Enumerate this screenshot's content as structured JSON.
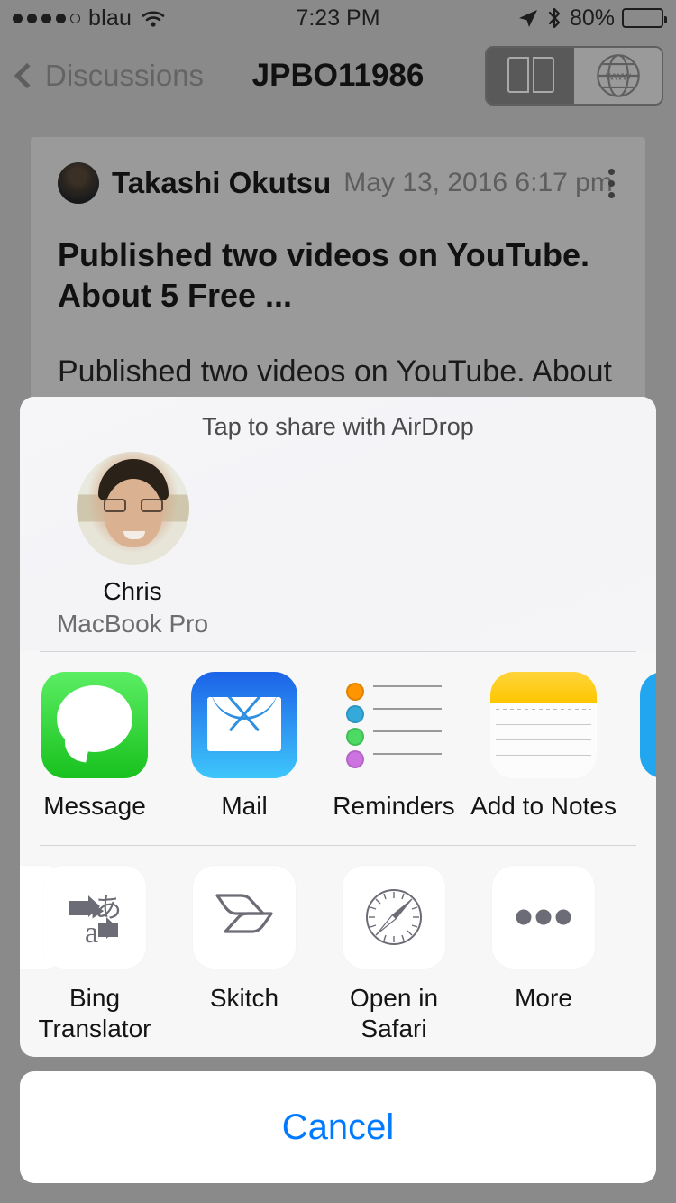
{
  "status_bar": {
    "carrier": "blau",
    "signal_dots_filled": 4,
    "signal_dots_total": 5,
    "wifi_icon": "wifi-icon",
    "time": "7:23 PM",
    "location_icon": "location-arrow-icon",
    "bluetooth_icon": "bluetooth-icon",
    "battery_percent": "80%",
    "battery_level": 80
  },
  "nav_bar": {
    "back_label": "Discussions",
    "back_icon": "chevron-left-icon",
    "title": "JPBO11986",
    "segmented_control": {
      "options": [
        {
          "name": "reader-view",
          "icon": "book-icon",
          "selected": true
        },
        {
          "name": "web-view",
          "icon": "globe-www-icon",
          "selected": false
        }
      ]
    }
  },
  "post": {
    "avatar": "author-avatar",
    "author": "Takashi Okutsu",
    "date": "May 13, 2016 6:17 pm",
    "menu_icon": "kebab-menu-icon",
    "title": "Published two videos on YouTube. About 5 Free ...",
    "body": "Published two videos on YouTube. About 5"
  },
  "share_sheet": {
    "airdrop": {
      "title": "Tap to share with AirDrop",
      "people": [
        {
          "name": "Chris",
          "device": "MacBook Pro",
          "avatar": "airdrop-contact-photo"
        }
      ]
    },
    "apps": [
      {
        "label": "Message",
        "icon": "messages-app-icon"
      },
      {
        "label": "Mail",
        "icon": "mail-app-icon"
      },
      {
        "label": "Reminders",
        "icon": "reminders-app-icon"
      },
      {
        "label": "Add to Notes",
        "icon": "notes-app-icon"
      },
      {
        "label": "",
        "icon": "blue-app-icon-partial"
      }
    ],
    "actions": [
      {
        "label": "",
        "icon": "action-icon-partial"
      },
      {
        "label": "Bing Translator",
        "icon": "bing-translator-icon"
      },
      {
        "label": "Skitch",
        "icon": "skitch-icon"
      },
      {
        "label": "Open in Safari",
        "icon": "safari-compass-icon"
      },
      {
        "label": "More",
        "icon": "more-ellipsis-icon"
      }
    ],
    "cancel_label": "Cancel"
  },
  "colors": {
    "accent_blue": "#007aff",
    "sheet_bg": "#f7f7f8",
    "backdrop": "#8a8a8a"
  }
}
